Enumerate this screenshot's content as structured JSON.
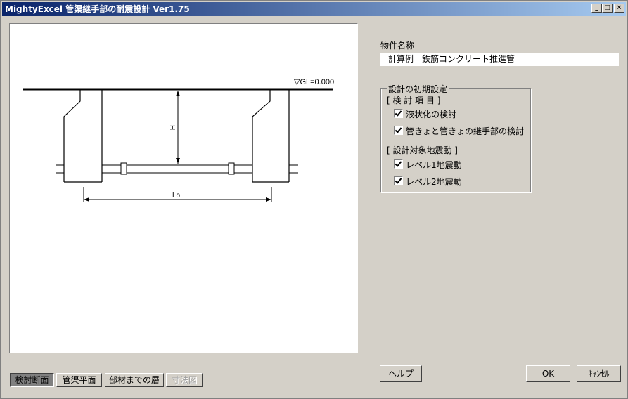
{
  "window": {
    "title": "MightyExcel 管渠継手部の耐震設計 Ver1.75",
    "minimize_glyph": "_",
    "maximize_glyph": "□",
    "close_glyph": "×"
  },
  "drawing": {
    "gl_label": "▽GL=0.000",
    "h_label": "H",
    "lo_label": "Lo"
  },
  "property": {
    "label": "物件名称",
    "value": "計算例　鉄筋コンクリート推進管"
  },
  "settings": {
    "group_title": "設計の初期設定",
    "section1": "[ 検 討 項 目 ]",
    "items1": [
      "液状化の検討",
      "管きょと管きょの継手部の検討"
    ],
    "section2": "[ 設計対象地震動 ]",
    "items2": [
      "レベル1地震動",
      "レベル2地震動"
    ]
  },
  "view_tabs": [
    "検討断面",
    "管渠平面",
    "部材までの層",
    "寸法図"
  ],
  "buttons": {
    "help": "ヘルプ",
    "ok": "OK",
    "cancel": "ｷｬﾝｾﾙ"
  }
}
